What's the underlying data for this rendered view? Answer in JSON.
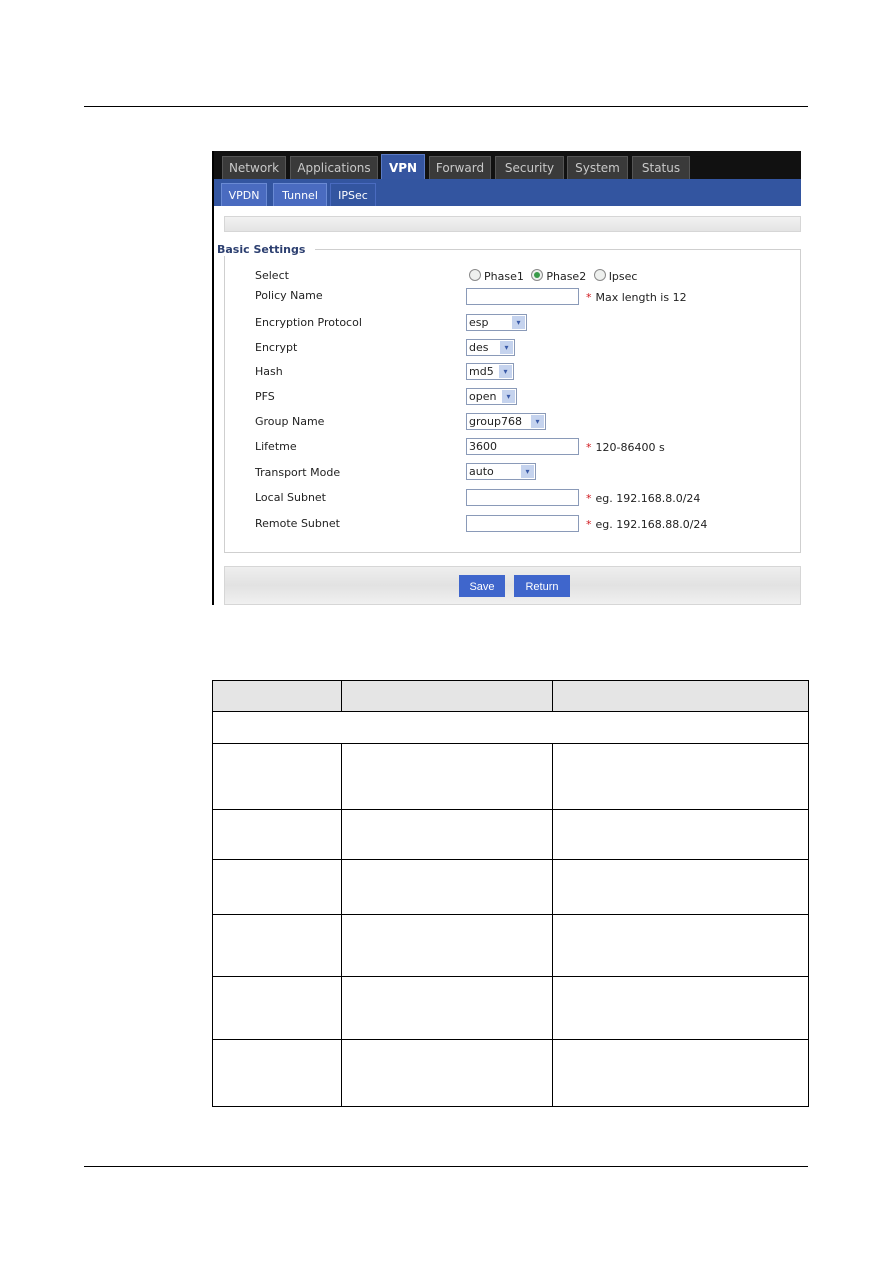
{
  "main_tabs": [
    {
      "label": "Network",
      "active": false
    },
    {
      "label": "Applications",
      "active": false
    },
    {
      "label": "VPN",
      "active": true
    },
    {
      "label": "Forward",
      "active": false
    },
    {
      "label": "Security",
      "active": false
    },
    {
      "label": "System",
      "active": false
    },
    {
      "label": "Status",
      "active": false
    }
  ],
  "sub_tabs": [
    {
      "label": "VPDN",
      "active": false
    },
    {
      "label": "Tunnel",
      "active": false
    },
    {
      "label": "IPSec",
      "active": true
    }
  ],
  "section_title": "Basic Settings",
  "form": {
    "select": {
      "label": "Select",
      "options": [
        "Phase1",
        "Phase2",
        "Ipsec"
      ],
      "selected": "Phase2"
    },
    "policy_name": {
      "label": "Policy Name",
      "value": "",
      "hint": "Max length is 12"
    },
    "encryption_protocol": {
      "label": "Encryption Protocol",
      "value": "esp"
    },
    "encrypt": {
      "label": "Encrypt",
      "value": "des"
    },
    "hash": {
      "label": "Hash",
      "value": "md5"
    },
    "pfs": {
      "label": "PFS",
      "value": "open"
    },
    "group_name": {
      "label": "Group Name",
      "value": "group768"
    },
    "lifetime": {
      "label": "Lifetme",
      "value": "3600",
      "hint": "120-86400 s"
    },
    "transport_mode": {
      "label": "Transport Mode",
      "value": "auto"
    },
    "local_subnet": {
      "label": "Local Subnet",
      "value": "",
      "hint": "eg. 192.168.8.0/24"
    },
    "remote_subnet": {
      "label": "Remote Subnet",
      "value": "",
      "hint": "eg. 192.168.88.0/24"
    },
    "required_mark": "*"
  },
  "buttons": {
    "save": "Save",
    "return": "Return"
  },
  "select_arrow_glyph": "▾",
  "colors": {
    "accent_blue": "#3355a0",
    "button_blue": "#3f66cc",
    "required_red": "#d0181e"
  }
}
